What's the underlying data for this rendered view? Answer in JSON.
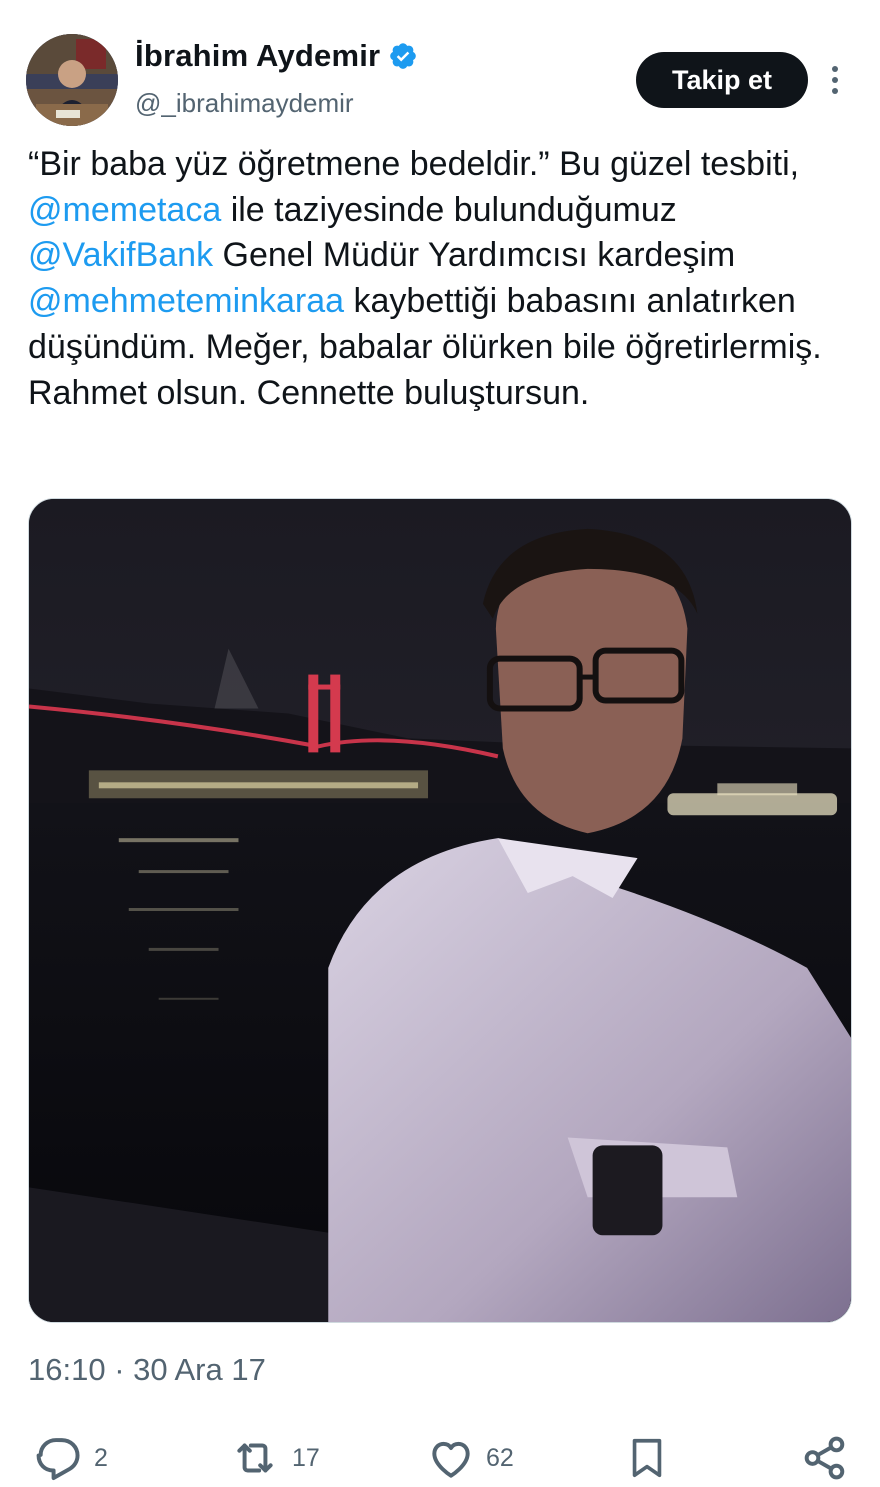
{
  "author": {
    "name": "İbrahim Aydemir",
    "handle": "@_ibrahimaydemir",
    "verified_icon": "verified-badge-icon",
    "follow_label": "Takip et",
    "more_icon": "more-vertical-icon"
  },
  "tweet": {
    "segments": [
      {
        "text": "“Bir baba yüz öğretmene bedeldir.” Bu güzel tesbiti, ",
        "mention": false
      },
      {
        "text": "@memetaca",
        "mention": true
      },
      {
        "text": " ile taziyesinde bulunduğumuz ",
        "mention": false
      },
      {
        "text": "@VakifBank",
        "mention": true
      },
      {
        "text": " Genel Müdür Yardımcısı kardeşim ",
        "mention": false
      },
      {
        "text": "@mehmeteminkaraa",
        "mention": true
      },
      {
        "text": " kaybettiği babasını anlatırken düşündüm. Meğer, babalar ölürken bile öğretirlermiş. Rahmet olsun. Cennette buluştursun.",
        "mention": false
      }
    ],
    "timestamp": "16:10 · 30 Ara 17"
  },
  "actions": {
    "reply": {
      "icon": "reply-icon",
      "count": "2"
    },
    "retweet": {
      "icon": "retweet-icon",
      "count": "17"
    },
    "like": {
      "icon": "heart-icon",
      "count": "62"
    },
    "bookmark": {
      "icon": "bookmark-icon"
    },
    "share": {
      "icon": "share-icon"
    }
  },
  "colors": {
    "accent": "#1d9bf0",
    "text": "#0f1419",
    "muted": "#536471",
    "button_bg": "#0f1419"
  }
}
